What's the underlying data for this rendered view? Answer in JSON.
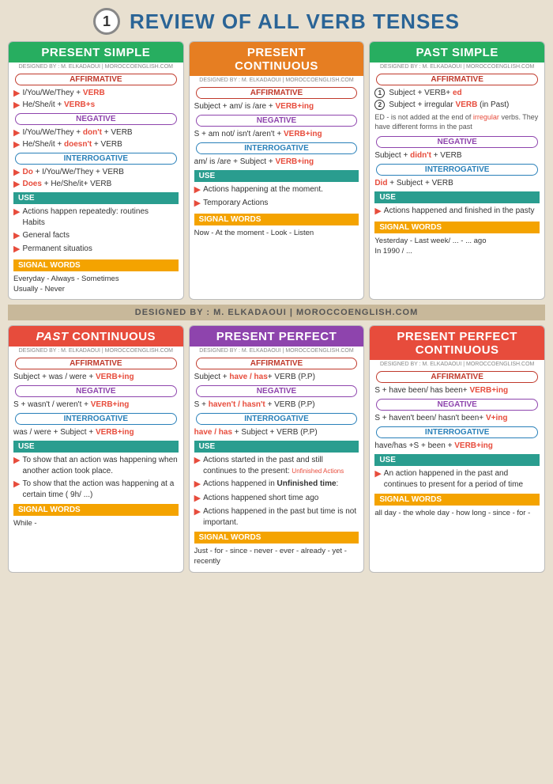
{
  "page": {
    "number": "1",
    "title": "REVIEW OF ALL VERB TENSES",
    "designed_by": "DESIGNED BY : M. ELKADAOUI  |  MOROCCOENGLISH.COM"
  },
  "cards": {
    "present_simple": {
      "title": "PRESENT SIMPLE",
      "designed_by": "DESIGNED BY : M. ELKADAOUI | MOROCCOENGLISH.COM",
      "affirmative": {
        "label": "AFFIRMATIVE",
        "rows": [
          "I/You/We/They + VERB",
          "He/She/it + VERB+s"
        ]
      },
      "negative": {
        "label": "NEGATIVE",
        "rows": [
          "I/You/We/They + don't + VERB",
          "He/She/it + doesn't + VERB"
        ]
      },
      "interrogative": {
        "label": "INTERROGATIVE",
        "rows": [
          "Do + I/You/We/They + VERB",
          "Does + He/She/it+ VERB"
        ]
      },
      "use_label": "USE",
      "use_items": [
        "Actions happen repeatedly: routines",
        "Habits",
        "General facts",
        "Permanent situatios"
      ],
      "signal_label": "SIGNAL WORDS",
      "signal_text": "Everyday - Always - Sometimes\nUsually - Never"
    },
    "present_continuous": {
      "title": "PRESENT CONTINUOUS",
      "designed_by": "DESIGNED BY : M. ELKADAOUI | MOROCCOENGLISH.COM",
      "affirmative": {
        "label": "AFFIRMATIVE",
        "rows": [
          "Subject + am/ is /are + VERB+ing"
        ]
      },
      "negative": {
        "label": "NEGATIVE",
        "rows": [
          "S + am not/ isn't /aren't + VERB+ing"
        ]
      },
      "interrogative": {
        "label": "INTERROGATIVE",
        "rows": [
          "am/ is /are + Subject + VERB+ing"
        ]
      },
      "use_label": "USE",
      "use_items": [
        "Actions happening at the moment.",
        "Temporary Actions"
      ],
      "signal_label": "SIGNAL WORDS",
      "signal_text": "Now - At the moment - Look - Listen"
    },
    "past_simple": {
      "title": "PAST SIMPLE",
      "designed_by": "DESIGNED BY : M. ELKADAOUI | MOROCCOENGLISH.COM",
      "affirmative": {
        "label": "AFFIRMATIVE",
        "rows": [
          "Subject + VERB+ ed",
          "Subject + irregular VERB (in Past)"
        ]
      },
      "note": "ED - is not added at the end of irregular verbs. They have different forms in the past",
      "negative": {
        "label": "NEGATIVE",
        "rows": [
          "Subject + didn't + VERB"
        ]
      },
      "interrogative": {
        "label": "INTERROGATIVE",
        "rows": [
          "Did + Subject + VERB"
        ]
      },
      "use_label": "USE",
      "use_items": [
        "Actions happened and finished in the pasty"
      ],
      "signal_label": "SIGNAL WORDS",
      "signal_text": "Yesterday - Last week/ ... - ... ago\nIn 1990 / ..."
    },
    "past_continuous": {
      "title": "PAST CONTINUOUS",
      "designed_by": "DESIGNED BY : M. ELKADAOUI | MOROCCOENGLISH.COM",
      "affirmative": {
        "label": "AFFIRMATIVE",
        "rows": [
          "Subject + was / were + VERB+ing"
        ]
      },
      "negative": {
        "label": "NEGATIVE",
        "rows": [
          "S + wasn't / weren't + VERB+ing"
        ]
      },
      "interrogative": {
        "label": "INTERROGATIVE",
        "rows": [
          "was / were + Subject + VERB+ing"
        ]
      },
      "use_label": "USE",
      "use_items": [
        "To show that an action was happening  when another action took place.",
        "To show that the action was happening at a certain time ( 9h/ ...)"
      ],
      "signal_label": "SIGNAL WORDS",
      "signal_text": "While -"
    },
    "present_perfect": {
      "title": "PRESENT PERFECT",
      "designed_by": "DESIGNED BY : M. ELKADAOUI | MOROCCOENGLISH.COM",
      "affirmative": {
        "label": "AFFIRMATIVE",
        "rows": [
          "Subject + have / has+ VERB (P.P)"
        ]
      },
      "negative": {
        "label": "NEGATIVE",
        "rows": [
          "S + haven't / hasn't + VERB (P.P)"
        ]
      },
      "interrogative": {
        "label": "INTERROGATIVE",
        "rows": [
          "have / has + Subject + VERB (P.P)"
        ]
      },
      "use_label": "USE",
      "use_items": [
        "Actions started in the past and still continues to the present: Unfinished Actions",
        "Actions happened in Unfinished time:",
        "Actions happened short time ago",
        "Actions happened in the past but time is not important."
      ],
      "signal_label": "SIGNAL WORDS",
      "signal_text": "Just - for - since - never - ever - already - yet - recently"
    },
    "present_perfect_continuous": {
      "title": "PRESENT PERFECT CONTINUOUS",
      "designed_by": "DESIGNED BY : M. ELKADAOUI | MOROCCOENGLISH.COM",
      "affirmative": {
        "label": "AFFIRMATIVE",
        "rows": [
          "S + have been/ has been+ VERB+ing"
        ]
      },
      "negative": {
        "label": "NEGATIVE",
        "rows": [
          "S + haven't been/ hasn't been+ V+ing"
        ]
      },
      "interrogative": {
        "label": "INTERROGATIVE",
        "rows": [
          "have/has +S + been + VERB+ing"
        ]
      },
      "use_label": "USE",
      "use_items": [
        "An action happened in the past and continues to present for a period of time"
      ],
      "signal_label": "SIGNAL WORDS",
      "signal_text": "all day - the whole day - how long - since - for -"
    }
  }
}
